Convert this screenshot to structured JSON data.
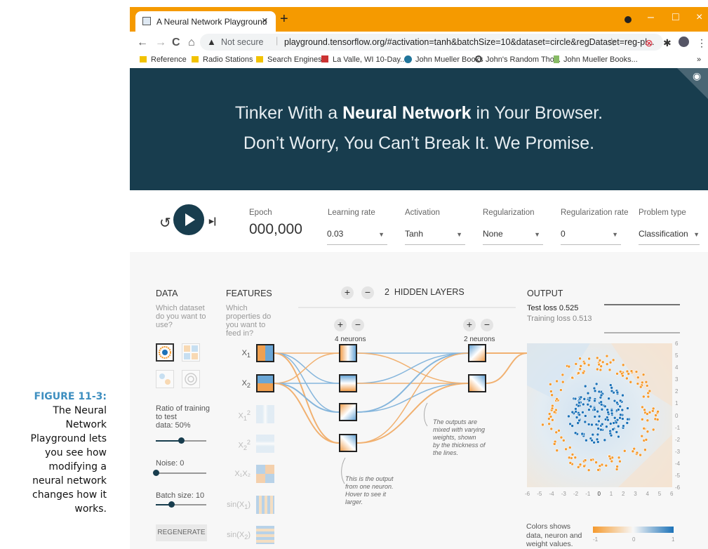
{
  "caption": {
    "figure_label": "FIGURE 11-3:",
    "lines": [
      "The Neural",
      "Network",
      "Playground lets",
      "you see how",
      "modifying a",
      "neural network",
      "changes how it",
      "works."
    ]
  },
  "browser": {
    "tab_title": "A Neural Network Playground",
    "tab_close": "×",
    "new_tab": "+",
    "window_buttons": [
      "–",
      "□",
      "×"
    ],
    "nav": {
      "back": "←",
      "forward": "→",
      "reload": "C",
      "home": "⌂"
    },
    "security_icon": "▲",
    "security_text": "Not secure",
    "url": "playground.tensorflow.org/#activation=tanh&batchSize=10&dataset=circle&regDataset=reg-pl...",
    "star": "☆",
    "more": "⋮",
    "bookmarks": [
      {
        "label": "Reference",
        "icon": "folder-icon"
      },
      {
        "label": "Radio Stations",
        "icon": "folder-icon"
      },
      {
        "label": "Search Engines",
        "icon": "folder-icon"
      },
      {
        "label": "La Valle, WI 10-Day...",
        "icon": "weather-icon"
      },
      {
        "label": "John Mueller Books",
        "icon": "wordpress-icon"
      },
      {
        "label": "John's Random Tho...",
        "icon": "globe-icon"
      },
      {
        "label": "John Mueller Books...",
        "icon": "book-icon"
      }
    ],
    "bookmarks_more": "»"
  },
  "hero": {
    "line1_pre": "Tinker With a ",
    "line1_bold": "Neural Network",
    "line1_post": " in Your Browser.",
    "line2": "Don’t Worry, You Can’t Break It. We Promise."
  },
  "controls": {
    "reset_icon": "↺",
    "step_icon": "▸|",
    "epoch_label": "Epoch",
    "epoch_value": "000,000",
    "learning_rate": {
      "label": "Learning rate",
      "value": "0.03"
    },
    "activation": {
      "label": "Activation",
      "value": "Tanh"
    },
    "regularization": {
      "label": "Regularization",
      "value": "None"
    },
    "regularization_rate": {
      "label": "Regularization rate",
      "value": "0"
    },
    "problem_type": {
      "label": "Problem type",
      "value": "Classification"
    },
    "dropdown_arrow": "▼"
  },
  "data_panel": {
    "header": "DATA",
    "question": [
      "Which dataset",
      "do you want to",
      "use?"
    ],
    "ratio_label": [
      "Ratio of training",
      "to test"
    ],
    "ratio_value_label": "data:  50%",
    "ratio_fraction": 0.5,
    "noise_label": "Noise:  0",
    "noise_fraction": 0.0,
    "batch_label": "Batch size:  10",
    "batch_fraction": 0.3,
    "regenerate": "REGENERATE"
  },
  "features": {
    "header": "FEATURES",
    "question": [
      "Which",
      "properties do",
      "you want to",
      "feed in?"
    ],
    "items": [
      {
        "base": "X",
        "sub": "1",
        "sup": "",
        "active": true
      },
      {
        "base": "X",
        "sub": "2",
        "sup": "",
        "active": true
      },
      {
        "base": "X",
        "sub": "1",
        "sup": "2",
        "active": false
      },
      {
        "base": "X",
        "sub": "2",
        "sup": "2",
        "active": false
      },
      {
        "base": "X₁X₂",
        "sub": "",
        "sup": "",
        "active": false
      },
      {
        "base": "sin(X",
        "sub": "1",
        "sup": "",
        "close": ")",
        "active": false
      },
      {
        "base": "sin(X",
        "sub": "2",
        "sup": "",
        "close": ")",
        "active": false
      }
    ]
  },
  "network": {
    "plus": "+",
    "minus": "−",
    "hidden_layers_count": "2",
    "hidden_layers_label": "HIDDEN LAYERS",
    "layer1_neurons": "4 neurons",
    "layer2_neurons": "2 neurons",
    "note_weights": [
      "The outputs are",
      "mixed with varying",
      "weights, shown",
      "by the thickness of",
      "the lines."
    ],
    "note_neuron": [
      "This is the output",
      "from one neuron.",
      "Hover to see it",
      "larger."
    ]
  },
  "output": {
    "header": "OUTPUT",
    "test_loss": "Test loss 0.525",
    "training_loss": "Training loss 0.513",
    "y_ticks": [
      "6",
      "5",
      "4",
      "3",
      "2",
      "1",
      "0",
      "-1",
      "-2",
      "-3",
      "-4",
      "-5",
      "-6"
    ],
    "x_ticks": [
      "-6",
      "-5",
      "-4",
      "-3",
      "-2",
      "-1",
      "0",
      "1",
      "2",
      "3",
      "4",
      "5",
      "6"
    ],
    "colors_note": [
      "Colors shows",
      "data, neuron and",
      "weight values."
    ],
    "gradient_ticks": [
      "-1",
      "0",
      "1"
    ],
    "colors": {
      "positive": "#1c72b8",
      "negative": "#f59a2e"
    }
  }
}
